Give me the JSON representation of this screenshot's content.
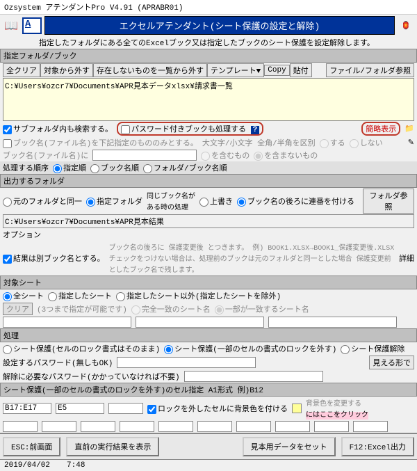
{
  "title": "Ozsystem アテンダントPro V4.91 (APRABR01)",
  "banner": "エクセルアテンダント(シート保護の設定と解除)",
  "description": "指定したフォルダにある全てのExcelブック又は指定したブックのシート保護を設定解除します。",
  "section1_label": "指定フォルダ/ブック",
  "toolbar": {
    "clear": "全クリア",
    "exclude": "対象から外す",
    "missing": "存在しないものを一覧から外す",
    "template": "テンプレート▼",
    "copy": "Copy",
    "paste": "貼付",
    "fileref": "ファイル/フォルダ参照"
  },
  "folder_value": "C:¥Users¥ozcr7¥Documents¥APR見本データxlsx¥請求書一覧",
  "opts": {
    "subfolder": "サブフォルダ内も検索する。",
    "password_book": "パスワード付きブックも処理する",
    "brief": "簡略表示",
    "filter_label": "ブック名(ファイル名)を下記指定のもののみとする。",
    "case_label": "大文字/小文字 全角/半角を区別",
    "suru": "する",
    "shinai": "しない",
    "bookname_label": "ブック名(ファイル名)に",
    "contain": "を含むもの",
    "notcontain": "を含まないもの"
  },
  "order": {
    "label": "処理する順序",
    "opt1": "指定順",
    "opt2": "ブック名順",
    "opt3": "フォルダ/ブック名順"
  },
  "output": {
    "label": "出力するフォルダ",
    "opt1": "元のフォルダと同一",
    "opt2": "指定フォルダ",
    "note": "同じブック名が\nある時の処理",
    "opt3": "上書き",
    "opt4": "ブック名の後ろに連番を付ける",
    "ref": "フォルダ参照",
    "path": "C:¥Users¥ozcr7¥Documents¥APR見本結果"
  },
  "option": {
    "label": "オプション",
    "sep_book": "結果は別ブック名とする。",
    "note": "ブック名の後ろに 保護変更後 とつきます。 例) BOOK1.XLSX→BOOK1_保護変更後.XLSX\nチェックをつけない場合は、処理前のブックは元のフォルダと同一とした場合 保護変更前 としたブック名で残します。",
    "detail": "詳細"
  },
  "target": {
    "label": "対象シート",
    "all": "全シート",
    "specified": "指定したシート",
    "except": "指定したシート以外(指定したシートを除外)",
    "clear": "クリア",
    "hint": "(3つまで指定が可能です)",
    "exact": "完全一致のシート名",
    "partial": "一部が一致するシート名"
  },
  "process": {
    "label": "処理",
    "opt1": "シート保護(セルのロック書式はそのまま)",
    "opt2": "シート保護(一部のセルの書式のロックを外す)",
    "opt3": "シート保護解除",
    "set_pw": "設定するパスワード(無しもOK)",
    "rel_pw": "解除に必要なパスワード(かかっていなければ不要)",
    "show": "見える形で"
  },
  "cell": {
    "label": "シート保護(一部のセルの書式のロックを外す)のセル指定  A1形式 例)B12",
    "v1": "B17:E17",
    "v2": "E5",
    "lock_color": "ロックを外したセルに背景色を付ける",
    "bg_note1": "背景色を変更する",
    "bg_note2": "にはここをクリック"
  },
  "bottom": {
    "esc": "ESC:前画面",
    "prev": "直前の実行結果を表示",
    "sample": "見本用データをセット",
    "f12": "F12:Excel出力"
  },
  "status": {
    "date": "2019/04/02",
    "time": "7:48"
  }
}
